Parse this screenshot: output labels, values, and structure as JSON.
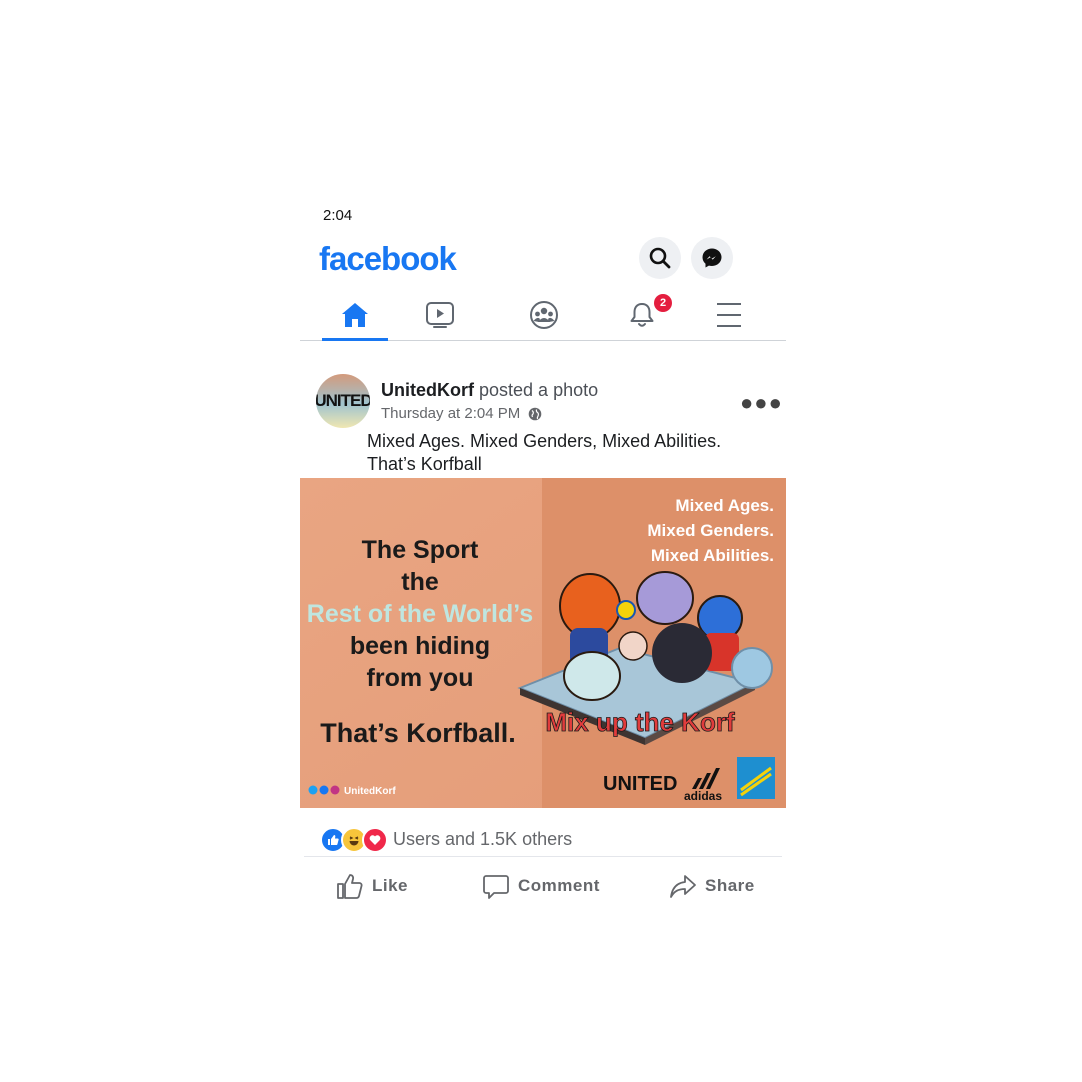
{
  "status_bar": {
    "time": "2:04"
  },
  "header": {
    "logo": "facebook",
    "search_icon": "search-icon",
    "messenger_icon": "messenger-icon"
  },
  "nav": {
    "items": [
      {
        "name": "home",
        "icon": "home-icon",
        "active": true
      },
      {
        "name": "watch",
        "icon": "video-icon"
      },
      {
        "name": "groups",
        "icon": "groups-icon"
      },
      {
        "name": "notifications",
        "icon": "bell-icon",
        "badge": "2"
      },
      {
        "name": "menu",
        "icon": "menu-icon"
      }
    ]
  },
  "post": {
    "avatar_text": "UNITED",
    "author": "UnitedKorf",
    "action": "posted a photo",
    "timestamp": "Thursday at 2:04 PM",
    "privacy_icon": "globe-icon",
    "caption": "Mixed Ages. Mixed Genders, Mixed Abilities. That’s Korfball",
    "photo": {
      "left_lines": [
        "The Sport",
        "the",
        "Rest of the World’s",
        "been hiding",
        "from you"
      ],
      "tagline": "That’s Korfball.",
      "right_lines": [
        "Mixed Ages.",
        "Mixed Genders.",
        "Mixed Abilities."
      ],
      "mix_slogan": "Mix up the Korf",
      "social_handle": "UnitedKorf",
      "brand_united": "UNITED",
      "brand_adidas": "adidas"
    },
    "reactions": {
      "icons": [
        "like-icon",
        "haha-icon",
        "love-icon"
      ],
      "summary": "Users and 1.5K others"
    },
    "actions": {
      "like": "Like",
      "comment": "Comment",
      "share": "Share"
    }
  },
  "colors": {
    "brand": "#1877f2",
    "badge": "#e41e3f",
    "photo_bg": "#e7a07c"
  }
}
